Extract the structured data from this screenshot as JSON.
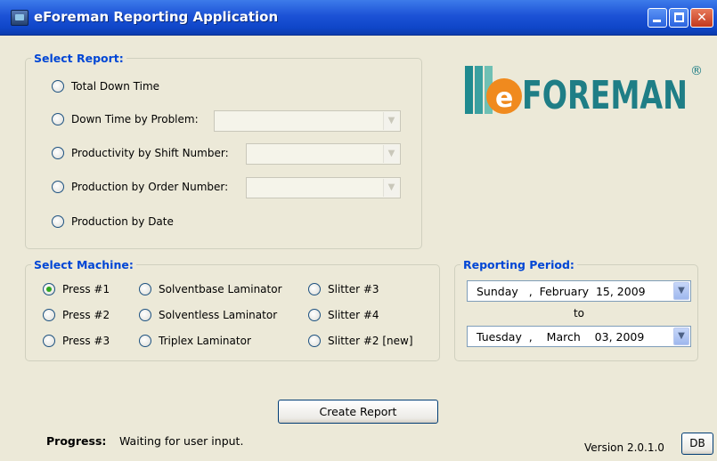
{
  "window": {
    "title": "eForeman Reporting Application"
  },
  "logo": {
    "text": "FOREMAN",
    "registered": "®",
    "e": "e"
  },
  "select_report": {
    "legend": "Select Report:",
    "options": [
      {
        "label": "Total Down Time",
        "checked": false
      },
      {
        "label": "Down Time by Problem:",
        "checked": false
      },
      {
        "label": "Productivity by Shift Number:",
        "checked": false
      },
      {
        "label": "Production by Order Number:",
        "checked": false
      },
      {
        "label": "Production by Date",
        "checked": false
      }
    ]
  },
  "select_machine": {
    "legend": "Select Machine:",
    "machines": [
      {
        "label": "Press #1",
        "checked": true
      },
      {
        "label": "Press #2",
        "checked": false
      },
      {
        "label": "Press #3",
        "checked": false
      },
      {
        "label": "Solventbase Laminator",
        "checked": false
      },
      {
        "label": "Solventless Laminator",
        "checked": false
      },
      {
        "label": "Triplex Laminator",
        "checked": false
      },
      {
        "label": "Slitter #3",
        "checked": false
      },
      {
        "label": "Slitter #4",
        "checked": false
      },
      {
        "label": "Slitter #2 [new]",
        "checked": false
      }
    ]
  },
  "reporting_period": {
    "legend": "Reporting Period:",
    "start": "Sunday   ,  February  15, 2009",
    "to_label": "to",
    "end": "Tuesday  ,    March    03, 2009"
  },
  "actions": {
    "create_report": "Create Report",
    "db": "DB"
  },
  "status": {
    "progress_label": "Progress:",
    "progress_text": "Waiting for user input.",
    "version": "Version 2.0.1.0"
  },
  "colors": {
    "titlebar": "#1c52d6",
    "group_legend": "#0046d5",
    "window_bg": "#ece9d8",
    "logo_orange": "#f08a1e",
    "logo_teal": "#1f8a8f"
  }
}
